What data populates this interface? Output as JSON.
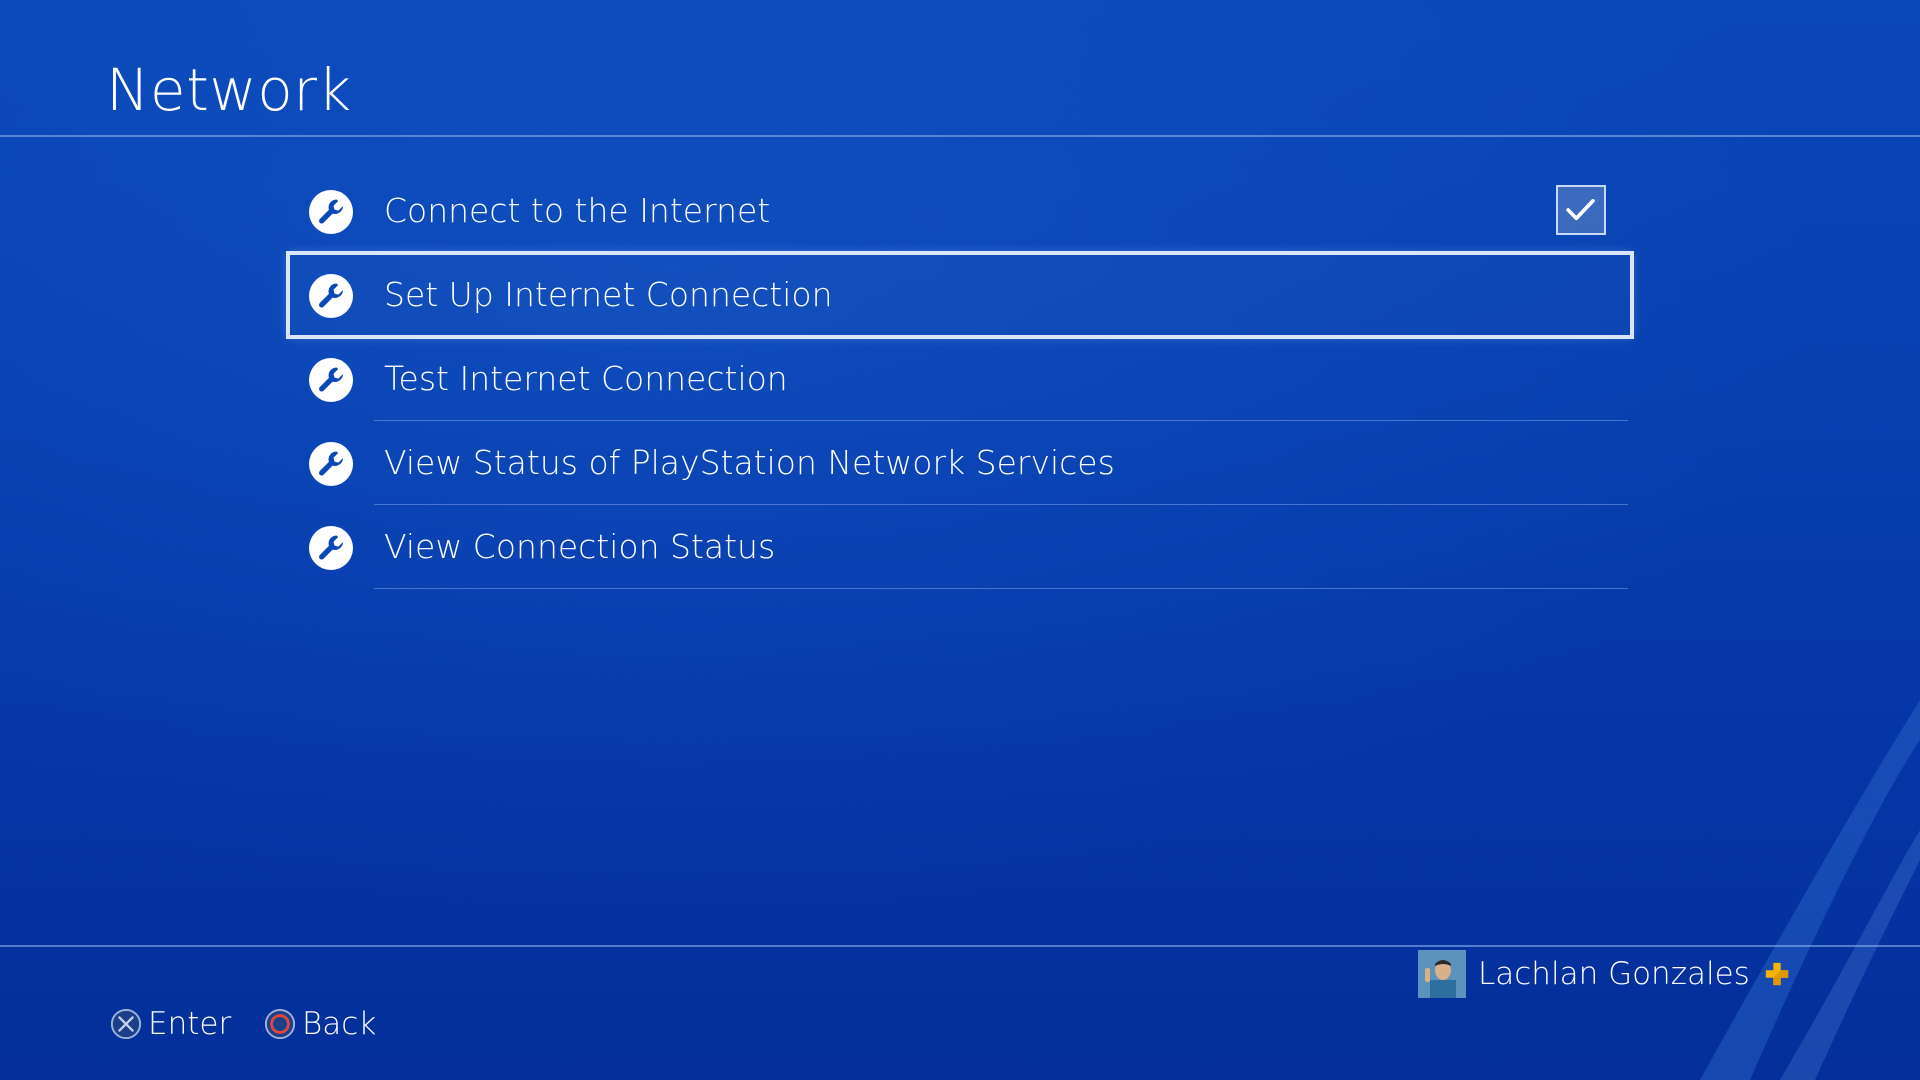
{
  "header": {
    "title": "Network"
  },
  "menu": {
    "items": [
      {
        "label": "Connect to the Internet",
        "icon": "wrench-icon",
        "checked": true
      },
      {
        "label": "Set Up Internet Connection",
        "icon": "wrench-icon",
        "selected": true
      },
      {
        "label": "Test Internet Connection",
        "icon": "wrench-icon"
      },
      {
        "label": "View Status of PlayStation Network Services",
        "icon": "wrench-icon"
      },
      {
        "label": "View Connection Status",
        "icon": "wrench-icon"
      }
    ]
  },
  "footer": {
    "enter_label": "Enter",
    "enter_icon": "cross-button-icon",
    "back_label": "Back",
    "back_icon": "circle-button-icon",
    "user_name": "Lachlan Gonzales",
    "user_badge": "playstation-plus-icon"
  },
  "colors": {
    "background": "#0840b0",
    "text": "#ffffff",
    "divider": "#96b9f0",
    "circle_button": "#e0463c",
    "plus_badge": "#f5b400"
  }
}
